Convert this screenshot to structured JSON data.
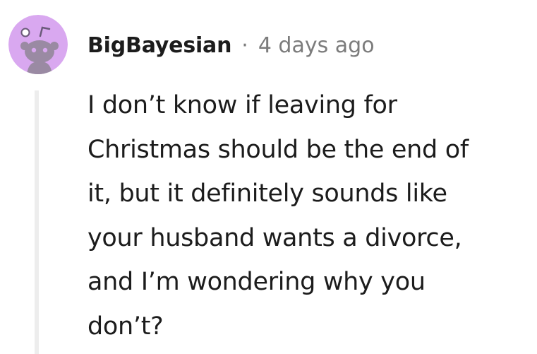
{
  "comment": {
    "username": "BigBayesian",
    "separator": "·",
    "timestamp": "4 days ago",
    "avatar_icon": "snoo-avatar-icon",
    "avatar_color": "#d9a8f0",
    "body_lines": [
      "I don’t know if leaving for",
      "Christmas should be the end of",
      "it, but it definitely sounds like",
      "your husband wants a divorce,",
      "and I’m wondering why you",
      "don’t?"
    ]
  }
}
